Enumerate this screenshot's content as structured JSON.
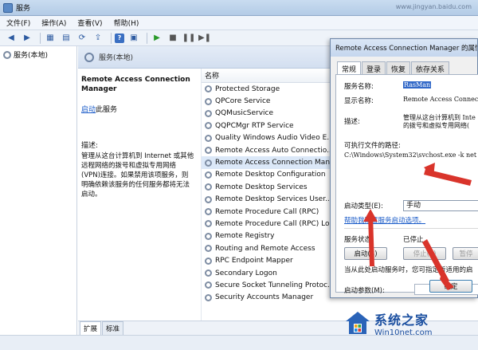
{
  "window": {
    "title": "服务",
    "blur_url": "www.jingyan.baidu.com"
  },
  "menu": [
    "文件(F)",
    "操作(A)",
    "查看(V)",
    "帮助(H)"
  ],
  "toolbar": {
    "icons": [
      "back-arrow-icon",
      "forward-arrow-icon",
      "console-tree-icon",
      "properties-icon",
      "refresh-icon",
      "export-icon",
      "help-icon",
      "show-hide-icon",
      "play-icon",
      "stop-icon",
      "pause-icon",
      "restart-icon"
    ]
  },
  "tree": {
    "root": "服务(本地)"
  },
  "content_header": "服务(本地)",
  "description": {
    "service_title": "Remote Access Connection Manager",
    "start_link": "启动",
    "start_suffix": "此服务",
    "desc_label": "描述:",
    "desc_text": "管理从这台计算机到 Internet 或其他远程网络的拨号和虚拟专用网络(VPN)连接。如果禁用该项服务，则明确依赖该服务的任何服务都将无法启动。"
  },
  "list": {
    "column": "名称",
    "rows": [
      "Protected Storage",
      "QPCore Service",
      "QQMusicService",
      "QQPCMgr RTP Service",
      "Quality Windows Audio Video E...",
      "Remote Access Auto Connectio...",
      "Remote Access Connection Man...",
      "Remote Desktop Configuration",
      "Remote Desktop Services",
      "Remote Desktop Services User...",
      "Remote Procedure Call (RPC)",
      "Remote Procedure Call (RPC) Lo...",
      "Remote Registry",
      "Routing and Remote Access",
      "RPC Endpoint Mapper",
      "Secondary Logon",
      "Secure Socket Tunneling Protoc...",
      "Security Accounts Manager"
    ]
  },
  "bottom_tabs": [
    "扩展",
    "标准"
  ],
  "dialog": {
    "title": "Remote Access Connection Manager 的属性",
    "tabs": [
      "常规",
      "登录",
      "恢复",
      "依存关系"
    ],
    "service_name_label": "服务名称:",
    "service_name": "RasMan",
    "display_name_label": "显示名称:",
    "display_name": "Remote Access Connectio",
    "desc_label": "描述:",
    "desc_line1": "管理从这台计算机到 Inte",
    "desc_line2": "的拨号和虚拟专用网络(",
    "path_label": "可执行文件的路径:",
    "path": "C:\\Windows\\System32\\svchost.exe -k net",
    "startup_type_label": "启动类型(E):",
    "startup_type": "手动",
    "help_link": "帮助我配置服务启动选项。",
    "status_label": "服务状态:",
    "status": "已停止",
    "btn_start": "启动(S)",
    "btn_stop": "停止(T)",
    "btn_pause": "暂停",
    "hint": "当从此处启动服务时，您可指定所适用的启",
    "params_label": "启动参数(M):",
    "btn_ok": "确定"
  },
  "watermark": {
    "main": "系统之家",
    "sub": "Win10net.com"
  },
  "colors": {
    "accent": "#3168c8",
    "arrow": "#d9342b",
    "link": "#1a5bc8"
  }
}
